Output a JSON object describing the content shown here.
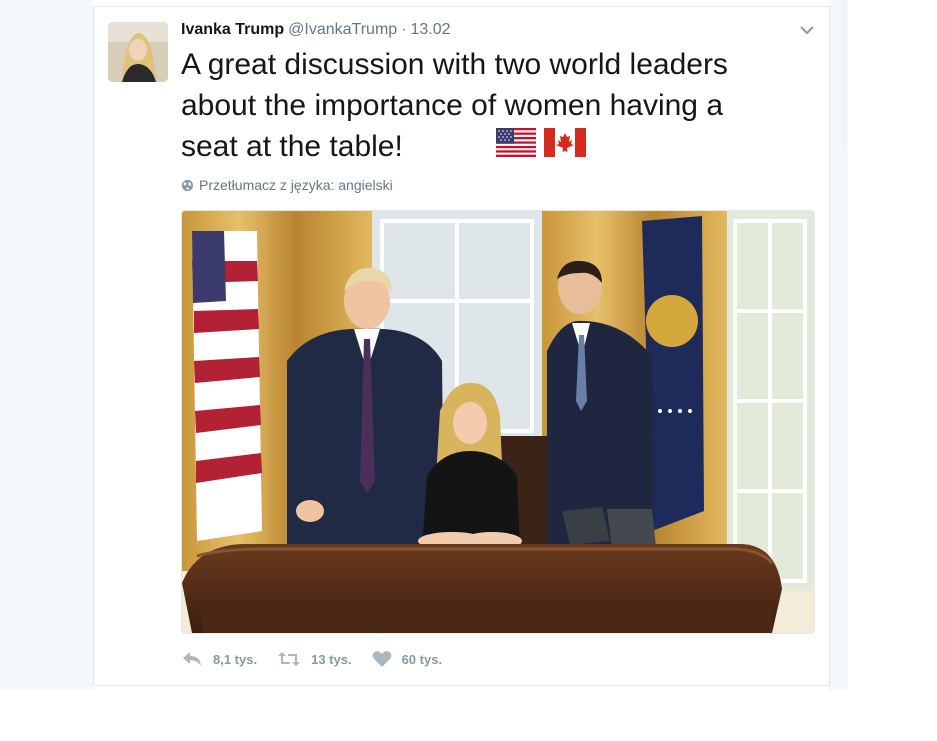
{
  "tweet": {
    "author_name": "Ivanka Trump",
    "handle": "@IvankaTrump",
    "separator": "·",
    "timestamp": "13.02",
    "text": "A great discussion with two world leaders\nabout the importance of women having a\nseat at the table!",
    "flags": [
      "flag-us-icon",
      "flag-canada-icon"
    ],
    "translate_label": "Przetłumacz z języka: angielski",
    "photo_alt": "photo",
    "actions": {
      "reply_count": "8,1 tys.",
      "retweet_count": "13 tys.",
      "like_count": "60 tys."
    }
  },
  "colors": {
    "text_primary": "#14171a",
    "text_secondary": "#657786",
    "action_gray": "#8899a6",
    "border": "#e1e8ed",
    "page_bg": "#f5f8fa"
  }
}
